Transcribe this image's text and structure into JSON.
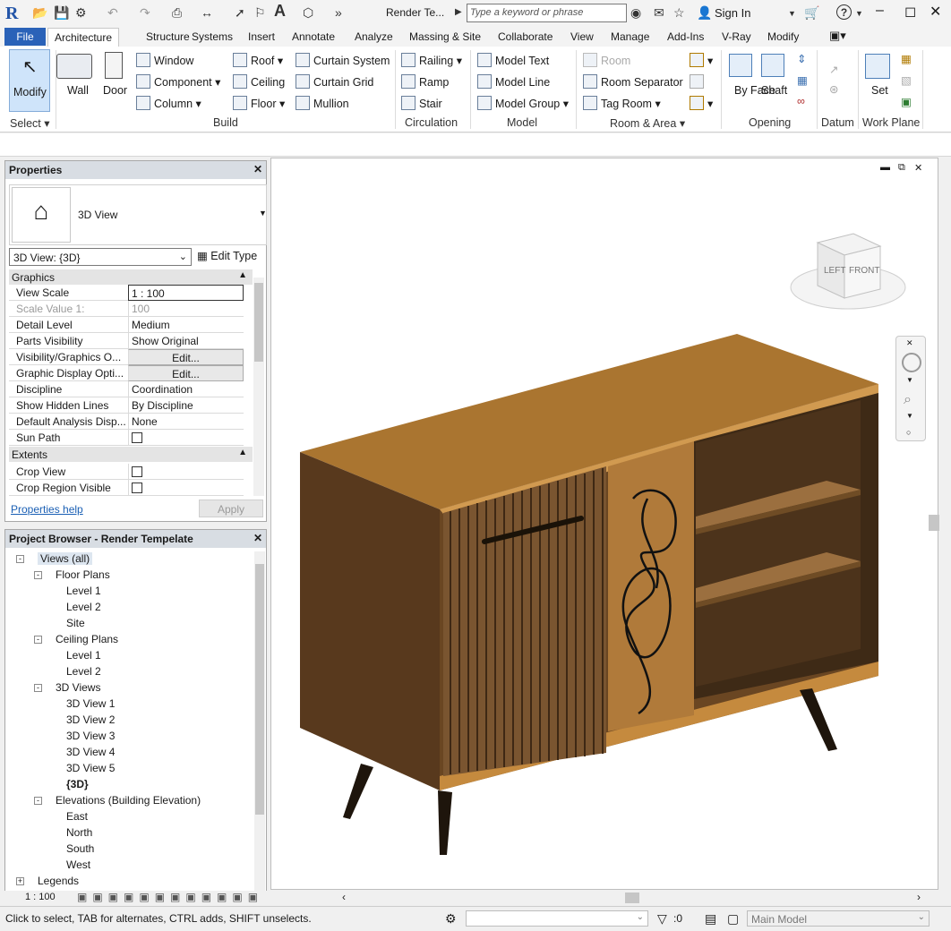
{
  "app": {
    "logo": "R",
    "doc_title": "Render Te...",
    "search_placeholder": "Type a keyword or phrase",
    "sign_in": "Sign In"
  },
  "tabs": [
    "File",
    "Architecture",
    "Structure",
    "Systems",
    "Insert",
    "Annotate",
    "Analyze",
    "Massing & Site",
    "Collaborate",
    "View",
    "Manage",
    "Add-Ins",
    "V-Ray",
    "Modify"
  ],
  "ribbon": {
    "select": {
      "modify": "Modify",
      "group": "Select"
    },
    "build": {
      "wall": "Wall",
      "door": "Door",
      "window": "Window",
      "component": "Component",
      "column": "Column",
      "roof": "Roof",
      "ceiling": "Ceiling",
      "floor": "Floor",
      "curtain_system": "Curtain System",
      "curtain_grid": "Curtain Grid",
      "mullion": "Mullion",
      "group": "Build"
    },
    "circulation": {
      "railing": "Railing",
      "ramp": "Ramp",
      "stair": "Stair",
      "group": "Circulation"
    },
    "model": {
      "model_text": "Model Text",
      "model_line": "Model Line",
      "model_group": "Model Group",
      "group": "Model"
    },
    "room": {
      "room": "Room",
      "room_separator": "Room Separator",
      "tag_room": "Tag Room",
      "group": "Room & Area"
    },
    "opening": {
      "by_face": "By Face",
      "shaft": "Shaft",
      "group": "Opening"
    },
    "datum": {
      "group": "Datum"
    },
    "workplane": {
      "set": "Set",
      "group": "Work Plane"
    }
  },
  "properties": {
    "title": "Properties",
    "type_name": "3D View",
    "selector": "3D View: {3D}",
    "edit_type": "Edit Type",
    "sections": {
      "graphics": "Graphics",
      "extents": "Extents"
    },
    "rows": [
      {
        "k": "View Scale",
        "v": "1 : 100"
      },
      {
        "k": "Scale Value    1:",
        "v": "100"
      },
      {
        "k": "Detail Level",
        "v": "Medium"
      },
      {
        "k": "Parts Visibility",
        "v": "Show Original"
      },
      {
        "k": "Visibility/Graphics O...",
        "v": "Edit..."
      },
      {
        "k": "Graphic Display Opti...",
        "v": "Edit..."
      },
      {
        "k": "Discipline",
        "v": "Coordination"
      },
      {
        "k": "Show Hidden Lines",
        "v": "By Discipline"
      },
      {
        "k": "Default Analysis Disp...",
        "v": "None"
      },
      {
        "k": "Sun Path",
        "v": ""
      }
    ],
    "extents_rows": [
      {
        "k": "Crop View",
        "v": ""
      },
      {
        "k": "Crop Region Visible",
        "v": ""
      }
    ],
    "help": "Properties help",
    "apply": "Apply"
  },
  "browser": {
    "title": "Project Browser - Render Tempelate",
    "items": [
      {
        "t": "Views (all)",
        "lvl": 0,
        "tog": "-"
      },
      {
        "t": "Floor Plans",
        "lvl": 1,
        "tog": "-"
      },
      {
        "t": "Level 1",
        "lvl": 2
      },
      {
        "t": "Level 2",
        "lvl": 2
      },
      {
        "t": "Site",
        "lvl": 2
      },
      {
        "t": "Ceiling Plans",
        "lvl": 1,
        "tog": "-"
      },
      {
        "t": "Level 1",
        "lvl": 2
      },
      {
        "t": "Level 2",
        "lvl": 2
      },
      {
        "t": "3D Views",
        "lvl": 1,
        "tog": "-"
      },
      {
        "t": "3D View 1",
        "lvl": 2
      },
      {
        "t": "3D View 2",
        "lvl": 2
      },
      {
        "t": "3D View 3",
        "lvl": 2
      },
      {
        "t": "3D View 4",
        "lvl": 2
      },
      {
        "t": "3D View 5",
        "lvl": 2
      },
      {
        "t": "{3D}",
        "lvl": 2,
        "bold": true
      },
      {
        "t": "Elevations (Building Elevation)",
        "lvl": 1,
        "tog": "-"
      },
      {
        "t": "East",
        "lvl": 2
      },
      {
        "t": "North",
        "lvl": 2
      },
      {
        "t": "South",
        "lvl": 2
      },
      {
        "t": "West",
        "lvl": 2
      },
      {
        "t": "Legends",
        "lvl": 0,
        "tog": "+"
      }
    ]
  },
  "viewcube": {
    "left": "LEFT",
    "front": "FRONT"
  },
  "viewbar": {
    "scale": "1 : 100"
  },
  "status": {
    "hint": "Click to select, TAB for alternates, CTRL adds, SHIFT unselects.",
    "count": ":0",
    "model": "Main Model"
  }
}
